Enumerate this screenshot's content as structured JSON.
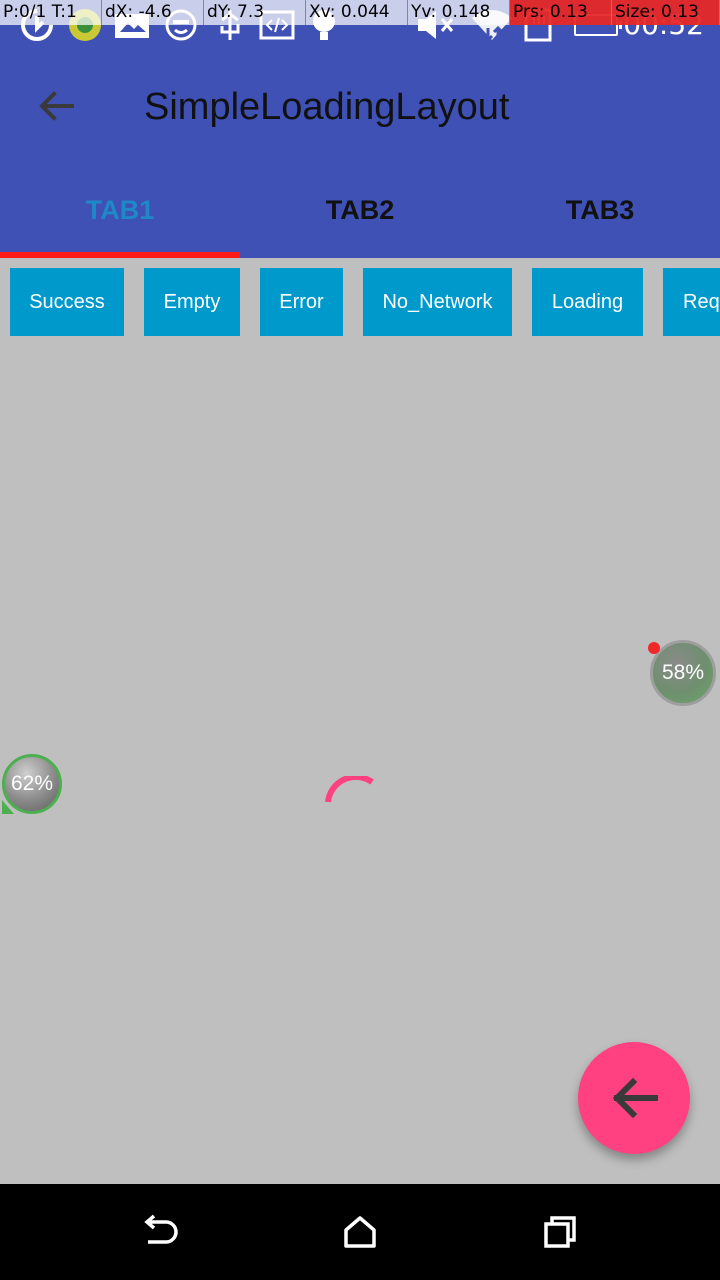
{
  "status_bar": {
    "time": "00:52",
    "icons": [
      "sync-icon",
      "app-icon",
      "photo-icon",
      "face-icon",
      "usb-icon",
      "code-icon",
      "bulb-icon",
      "mute-icon",
      "wifi-icon",
      "sd-card-icon",
      "battery-icon"
    ]
  },
  "pointer_overlay": {
    "pointer": "P:0/1",
    "touches": "T:1",
    "dx": "dX: -4.6",
    "dy": "dY: 7.3",
    "xv": "Xv: 0.044",
    "yv": "Yv: 0.148",
    "prs": "Prs: 0.13",
    "size": "Size: 0.13"
  },
  "toolbar": {
    "title": "SimpleLoadingLayout",
    "back_icon": "arrow-back-icon"
  },
  "tabs": [
    {
      "label": "TAB1",
      "active": true
    },
    {
      "label": "TAB2",
      "active": false
    },
    {
      "label": "TAB3",
      "active": false
    }
  ],
  "colors": {
    "primary": "#3f51b5",
    "tab_active": "#1e88c8",
    "tab_indicator": "#ff1a1a",
    "state_button": "#0099cc",
    "accent": "#ff4081",
    "content_background": "#bfbfbf"
  },
  "state_buttons": [
    {
      "label": "Success"
    },
    {
      "label": "Empty"
    },
    {
      "label": "Error"
    },
    {
      "label": "No_Network"
    },
    {
      "label": "Loading"
    },
    {
      "label": "Requ"
    }
  ],
  "monitor_bubbles": [
    {
      "label": "58%"
    },
    {
      "label": "62%"
    }
  ],
  "fab": {
    "icon": "arrow-back-icon"
  },
  "nav_bar": {
    "back_icon": "nav-back-icon",
    "home_icon": "home-icon",
    "recents_icon": "recents-icon"
  }
}
